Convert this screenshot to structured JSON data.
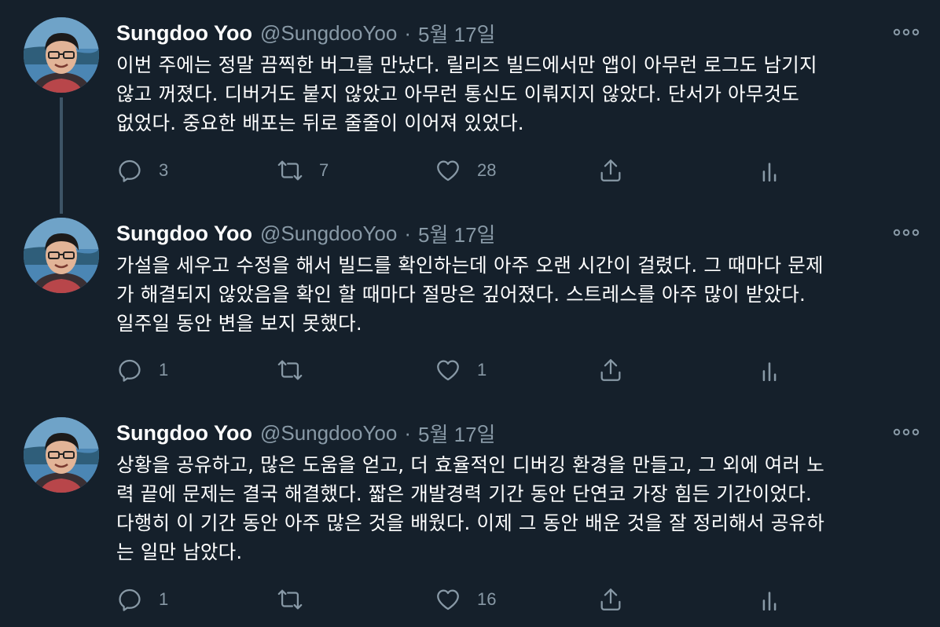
{
  "colors": {
    "background": "#15202b",
    "text": "#ffffff",
    "secondary_text": "#8899a6",
    "thread_line": "#3d5466"
  },
  "tweets": [
    {
      "name": "Sungdoo Yoo",
      "handle": "@SungdooYoo",
      "separator": "·",
      "date": "5월 17일",
      "text": "이번 주에는 정말 끔찍한 버그를 만났다. 릴리즈 빌드에서만 앱이 아무런 로그도 남기지\n않고 꺼졌다. 디버거도 붙지 않았고 아무런 통신도  이뤄지지 않았다. 단서가 아무것도\n없었다. 중요한 배포는 뒤로 줄줄이 이어져 있었다.",
      "reply_count": "3",
      "retweet_count": "7",
      "like_count": "28",
      "icons": [
        "reply-icon",
        "retweet-icon",
        "like-icon",
        "share-icon",
        "analytics-icon",
        "more-icon"
      ]
    },
    {
      "name": "Sungdoo Yoo",
      "handle": "@SungdooYoo",
      "separator": "·",
      "date": "5월 17일",
      "text": "가설을 세우고 수정을 해서 빌드를 확인하는데 아주 오랜 시간이 걸렸다. 그 때마다 문제\n가 해결되지 않았음을 확인 할 때마다 절망은 깊어졌다. 스트레스를 아주 많이 받았다.\n일주일 동안 변을 보지 못했다.",
      "reply_count": "1",
      "retweet_count": "",
      "like_count": "1",
      "icons": [
        "reply-icon",
        "retweet-icon",
        "like-icon",
        "share-icon",
        "analytics-icon",
        "more-icon"
      ]
    },
    {
      "name": "Sungdoo Yoo",
      "handle": "@SungdooYoo",
      "separator": "·",
      "date": "5월 17일",
      "text": "상황을 공유하고, 많은 도움을 얻고, 더 효율적인 디버깅 환경을 만들고, 그 외에 여러 노\n력 끝에 문제는 결국 해결했다. 짧은 개발경력 기간 동안 단연코 가장 힘든 기간이었다.\n다행히 이 기간 동안 아주 많은 것을 배웠다. 이제 그 동안 배운 것을 잘 정리해서 공유하\n는 일만 남았다.",
      "reply_count": "1",
      "retweet_count": "",
      "like_count": "16",
      "icons": [
        "reply-icon",
        "retweet-icon",
        "like-icon",
        "share-icon",
        "analytics-icon",
        "more-icon"
      ]
    }
  ]
}
